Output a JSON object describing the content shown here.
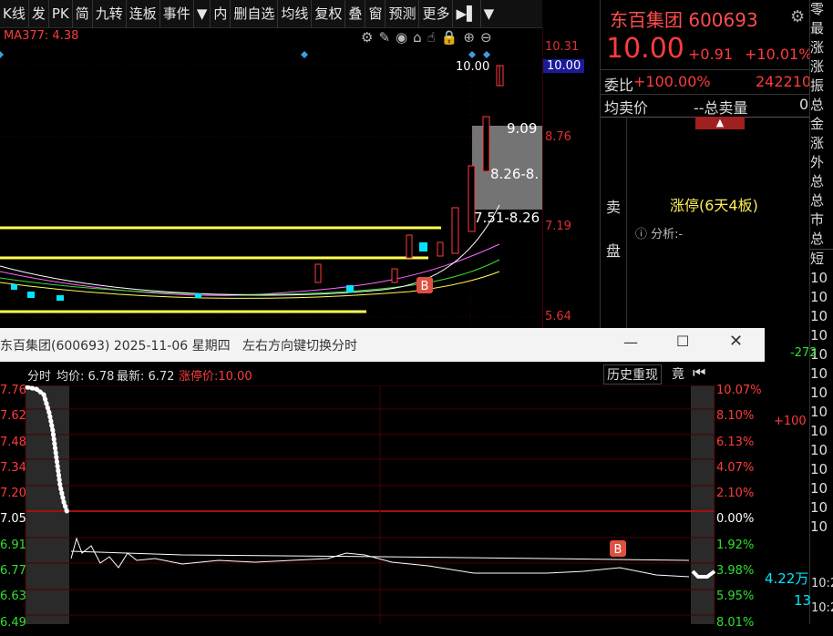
{
  "toolbar": {
    "items": [
      "K线",
      "发",
      "PK",
      "简",
      "九转",
      "连板",
      "事件",
      "内",
      "删自选",
      "均线",
      "复权",
      "叠",
      "窗",
      "预测",
      "更多"
    ]
  },
  "kchart": {
    "ma_label": "MA377: 4.38",
    "price_labels": [
      "10.31",
      "10.00",
      "8.76",
      "7.19",
      "5.64"
    ],
    "current_price_tag": "10.00",
    "annot_top": "10.00",
    "annot_1": "9.09",
    "annot_2": "8.26-8.",
    "annot_3": "7.51-8.26",
    "marker_b": "B",
    "colors": {
      "up": "#ff3b3b",
      "down": "#00e5ff",
      "yellow": "#ffff55",
      "white": "#ffffff",
      "magenta": "#ff66ff",
      "green": "#33dd33"
    }
  },
  "quote": {
    "name": "东百集团",
    "code": "600693",
    "price": "10.00",
    "change": "+0.91",
    "change_pct": "+10.01%",
    "weibi_label": "委比",
    "weibi_value": "+100.00%",
    "weibi_count": "242210",
    "avg_label": "均卖价",
    "total_label": "--总卖量",
    "total_value": "0",
    "sell_label_1": "卖",
    "sell_label_2": "盘",
    "limit_text": "涨停(6天4板)",
    "analysis": "分析:-"
  },
  "sidebar": {
    "items": [
      "零",
      "最",
      "涨",
      "涨",
      "振",
      "总",
      "金",
      "涨",
      "外",
      "总",
      "总",
      "市",
      "总",
      "短",
      "10",
      "10",
      "10",
      "10",
      "10",
      "10",
      "10",
      "10",
      "10",
      "10",
      "10",
      "10",
      "10",
      "10"
    ]
  },
  "popup": {
    "title": "东百集团(600693) 2025-11-06 星期四",
    "hint": "左右方向键切换分时",
    "info_label": "分时",
    "avg_label": "均价: 6.78",
    "latest_label": "最新: 6.72",
    "limit_label": "涨停价:10.00",
    "history_btn": "历史重现",
    "auction_btn": "竟",
    "y_left": [
      "7.76",
      "7.62",
      "7.48",
      "7.34",
      "7.20",
      "7.05",
      "6.91",
      "6.77",
      "6.63",
      "6.49"
    ],
    "y_right": [
      "10.07%",
      "8.10%",
      "6.13%",
      "4.07%",
      "2.10%",
      "0.00%",
      "1.92%",
      "3.98%",
      "5.95%",
      "8.01%"
    ],
    "marker_b": "B"
  },
  "right_partial": {
    "v1": "-272",
    "v2": "+100",
    "v3": "4.22万",
    "v4": "13",
    "t1": "10:2",
    "t2": "10:2"
  }
}
